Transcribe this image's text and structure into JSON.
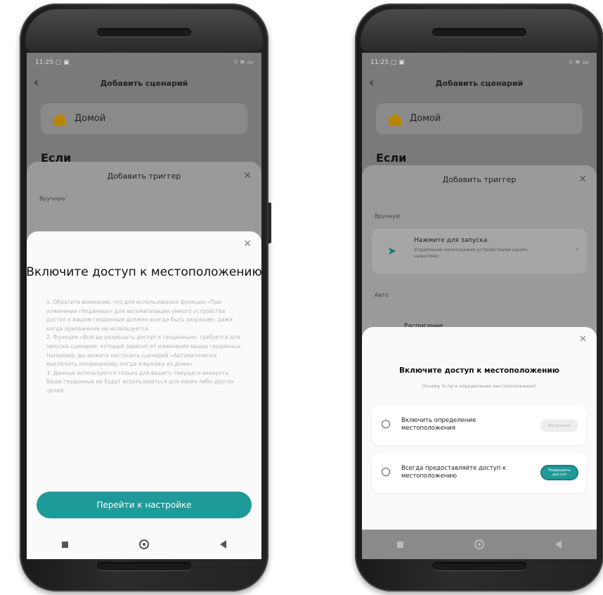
{
  "status": {
    "time_left": "11:25 ▢ ▣",
    "time_right": "11:25 ▢ ▣",
    "icons": "⁝⁝ ≋ ▭"
  },
  "appbar": {
    "back": "‹",
    "title": "Добавить сценарий"
  },
  "home": {
    "label": "Домой"
  },
  "if_label": "Если",
  "trigger_sheet": {
    "title": "Добавить триггер",
    "close": "✕",
    "manual": "Вручную",
    "auto": "Авто"
  },
  "left_dialog": {
    "close": "✕",
    "heading": "Включите доступ к местоположению",
    "body": "1. Обратите внимание, что для использования функции «При изменении геоданных» для автоматизации умного устройства доступ к вашим геоданным должен всегда быть разрешен, даже когда приложение не используется.\n2. Функция «Всегда разрешать доступ к геоданным» требуется для запуска сценария, который зависит от изменения ваших геоданных. Например, вы можете настроить сценарий «Автоматически выключать кондиционер, когда я выхожу из дома».\n3. Данные используются только для вашего текущего аккаунта. Ваши геоданные не будут использоваться для каких-либо других целей.",
    "button": "Перейти к настройке"
  },
  "right_screen": {
    "manual_card": {
      "title": "Нажмите для запуска",
      "desc": "Управление несколькими устройствами одним нажатием",
      "chevron": "›"
    },
    "schedule": "Расписание",
    "dialog": {
      "close": "✕",
      "heading": "Включите доступ к местоположению",
      "sub": "Почему Услуге определение местоположения?",
      "option1": {
        "label": "Включить определение местоположения",
        "action": "Включено"
      },
      "option2": {
        "label": "Всегда предоставляйте доступ к местоположению",
        "action": "Разрешить доступ"
      }
    }
  },
  "colors": {
    "accent": "#1e9a98"
  }
}
